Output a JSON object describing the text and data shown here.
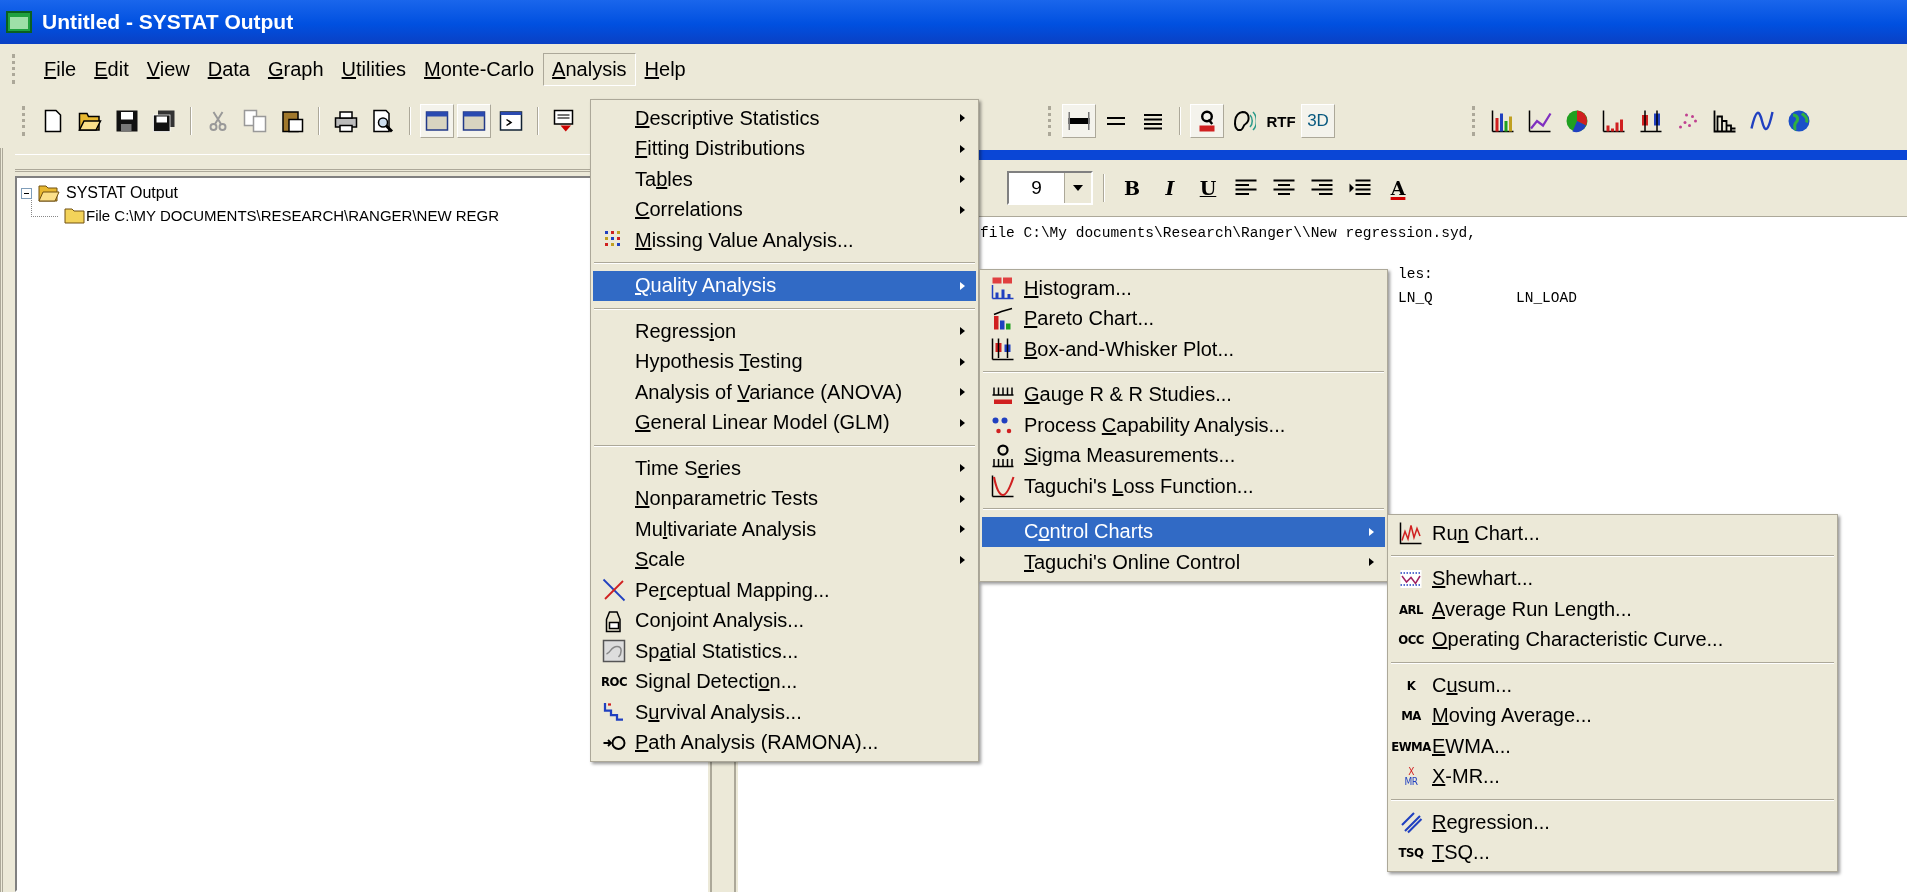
{
  "window": {
    "title": "Untitled - SYSTAT Output"
  },
  "menubar": [
    {
      "label": "File",
      "selected": false
    },
    {
      "label": "Edit",
      "selected": false
    },
    {
      "label": "View",
      "selected": false
    },
    {
      "label": "Data",
      "selected": false
    },
    {
      "label": "Graph",
      "selected": false
    },
    {
      "label": "Utilities",
      "selected": false
    },
    {
      "label": "Monte-Carlo",
      "selected": false
    },
    {
      "label": "Analysis",
      "selected": true
    },
    {
      "label": "Help",
      "selected": false
    }
  ],
  "toolbar_left": [
    {
      "kind": "button",
      "on": false
    },
    {
      "kind": "button",
      "on": false
    },
    {
      "kind": "button",
      "on": false
    },
    {
      "kind": "button",
      "on": false
    },
    {
      "kind": "separator"
    },
    {
      "kind": "button",
      "on": false
    },
    {
      "kind": "button",
      "on": false
    },
    {
      "kind": "button",
      "on": false
    },
    {
      "kind": "separator"
    },
    {
      "kind": "button",
      "on": false
    },
    {
      "kind": "button",
      "on": false
    },
    {
      "kind": "separator"
    },
    {
      "kind": "button",
      "on": true
    },
    {
      "kind": "button",
      "on": true
    },
    {
      "kind": "button",
      "on": false
    },
    {
      "kind": "separator"
    },
    {
      "kind": "button",
      "on": false
    }
  ],
  "toolbar_style": [
    {
      "kind": "button",
      "on": true
    },
    {
      "kind": "button",
      "on": false
    },
    {
      "kind": "button",
      "on": false
    },
    {
      "kind": "separator"
    },
    {
      "kind": "button",
      "on": true
    },
    {
      "kind": "button",
      "on": false
    },
    {
      "kind": "button",
      "text": "RTF",
      "on": false
    },
    {
      "kind": "button",
      "text": "3D",
      "on": true
    }
  ],
  "tree": {
    "label": "SYSTAT Output",
    "expanded": true,
    "children": [
      {
        "label": "File C:\\MY DOCUMENTS\\RESEARCH\\RANGER\\NEW REGR"
      }
    ]
  },
  "format_bar": {
    "font_size": "9",
    "buttons": [
      {
        "kind": "text",
        "text": "B"
      },
      {
        "kind": "text",
        "text": "I"
      },
      {
        "kind": "text",
        "text": "U"
      },
      {
        "kind": "icon"
      },
      {
        "kind": "icon"
      },
      {
        "kind": "icon"
      },
      {
        "kind": "icon"
      },
      {
        "kind": "text",
        "text": "A"
      }
    ]
  },
  "output": {
    "lines": [
      [
        "file C:\\My documents\\Research\\Ranger\\\\New regression.syd,"
      ],
      [
        "les:"
      ],
      [
        "LN_Q",
        "LN_LOAD"
      ]
    ]
  },
  "menus": [
    {
      "items": [
        {
          "kind": "item",
          "label": "Descriptive Statistics",
          "submenu": true,
          "selected": false
        },
        {
          "kind": "item",
          "label": "Fitting Distributions",
          "submenu": true,
          "selected": false
        },
        {
          "kind": "item",
          "label": "Tables",
          "submenu": true,
          "selected": false
        },
        {
          "kind": "item",
          "label": "Correlations",
          "submenu": true,
          "selected": false
        },
        {
          "kind": "item",
          "label": "Missing Value Analysis...",
          "submenu": false,
          "selected": false
        },
        {
          "kind": "separator"
        },
        {
          "kind": "item",
          "label": "Quality Analysis",
          "submenu": true,
          "selected": true
        },
        {
          "kind": "separator"
        },
        {
          "kind": "item",
          "label": "Regression",
          "submenu": true,
          "selected": false
        },
        {
          "kind": "item",
          "label": "Hypothesis Testing",
          "submenu": true,
          "selected": false
        },
        {
          "kind": "item",
          "label": "Analysis of Variance (ANOVA)",
          "submenu": true,
          "selected": false
        },
        {
          "kind": "item",
          "label": "General Linear Model (GLM)",
          "submenu": true,
          "selected": false
        },
        {
          "kind": "separator"
        },
        {
          "kind": "item",
          "label": "Time Series",
          "submenu": true,
          "selected": false
        },
        {
          "kind": "item",
          "label": "Nonparametric Tests",
          "submenu": true,
          "selected": false
        },
        {
          "kind": "item",
          "label": "Multivariate Analysis",
          "submenu": true,
          "selected": false
        },
        {
          "kind": "item",
          "label": "Scale",
          "submenu": true,
          "selected": false
        },
        {
          "kind": "item",
          "label": "Perceptual Mapping...",
          "submenu": false,
          "selected": false
        },
        {
          "kind": "item",
          "label": "Conjoint Analysis...",
          "submenu": false,
          "selected": false
        },
        {
          "kind": "item",
          "label": "Spatial Statistics...",
          "submenu": false,
          "selected": false
        },
        {
          "kind": "item",
          "label": "Signal Detection...",
          "submenu": false,
          "selected": false,
          "badge": [
            "ROC"
          ]
        },
        {
          "kind": "item",
          "label": "Survival Analysis...",
          "submenu": false,
          "selected": false
        },
        {
          "kind": "item",
          "label": "Path Analysis (RAMONA)...",
          "submenu": false,
          "selected": false
        }
      ]
    },
    {
      "items": [
        {
          "kind": "item",
          "label": "Histogram...",
          "submenu": false,
          "selected": false
        },
        {
          "kind": "item",
          "label": "Pareto Chart...",
          "submenu": false,
          "selected": false
        },
        {
          "kind": "item",
          "label": "Box-and-Whisker Plot...",
          "submenu": false,
          "selected": false
        },
        {
          "kind": "separator"
        },
        {
          "kind": "item",
          "label": "Gauge R & R Studies...",
          "submenu": false,
          "selected": false
        },
        {
          "kind": "item",
          "label": "Process Capability Analysis...",
          "submenu": false,
          "selected": false
        },
        {
          "kind": "item",
          "label": "Sigma Measurements...",
          "submenu": false,
          "selected": false
        },
        {
          "kind": "item",
          "label": "Taguchi's Loss Function...",
          "submenu": false,
          "selected": false
        },
        {
          "kind": "separator"
        },
        {
          "kind": "item",
          "label": "Control Charts",
          "submenu": true,
          "selected": true
        },
        {
          "kind": "item",
          "label": "Taguchi's Online Control",
          "submenu": true,
          "selected": false
        }
      ]
    },
    {
      "items": [
        {
          "kind": "item",
          "label": "Run Chart...",
          "submenu": false,
          "selected": false
        },
        {
          "kind": "separator"
        },
        {
          "kind": "item",
          "label": "Shewhart...",
          "submenu": false,
          "selected": false
        },
        {
          "kind": "item",
          "label": "Average Run Length...",
          "submenu": false,
          "selected": false,
          "badge": [
            "ARL"
          ]
        },
        {
          "kind": "item",
          "label": "Operating Characteristic Curve...",
          "submenu": false,
          "selected": false,
          "badge": [
            "OCC"
          ]
        },
        {
          "kind": "separator"
        },
        {
          "kind": "item",
          "label": "Cusum...",
          "submenu": false,
          "selected": false,
          "badge": [
            "K"
          ]
        },
        {
          "kind": "item",
          "label": "Moving Average...",
          "submenu": false,
          "selected": false,
          "badge": [
            "MA"
          ]
        },
        {
          "kind": "item",
          "label": "EWMA...",
          "submenu": false,
          "selected": false,
          "badge": [
            "EWMA"
          ]
        },
        {
          "kind": "item",
          "label": "X-MR...",
          "submenu": false,
          "selected": false,
          "badge": [
            "X",
            "MR"
          ]
        },
        {
          "kind": "separator"
        },
        {
          "kind": "item",
          "label": "Regression...",
          "submenu": false,
          "selected": false
        },
        {
          "kind": "item",
          "label": "TSQ...",
          "submenu": false,
          "selected": false,
          "badge": [
            "TSQ"
          ]
        }
      ]
    }
  ]
}
